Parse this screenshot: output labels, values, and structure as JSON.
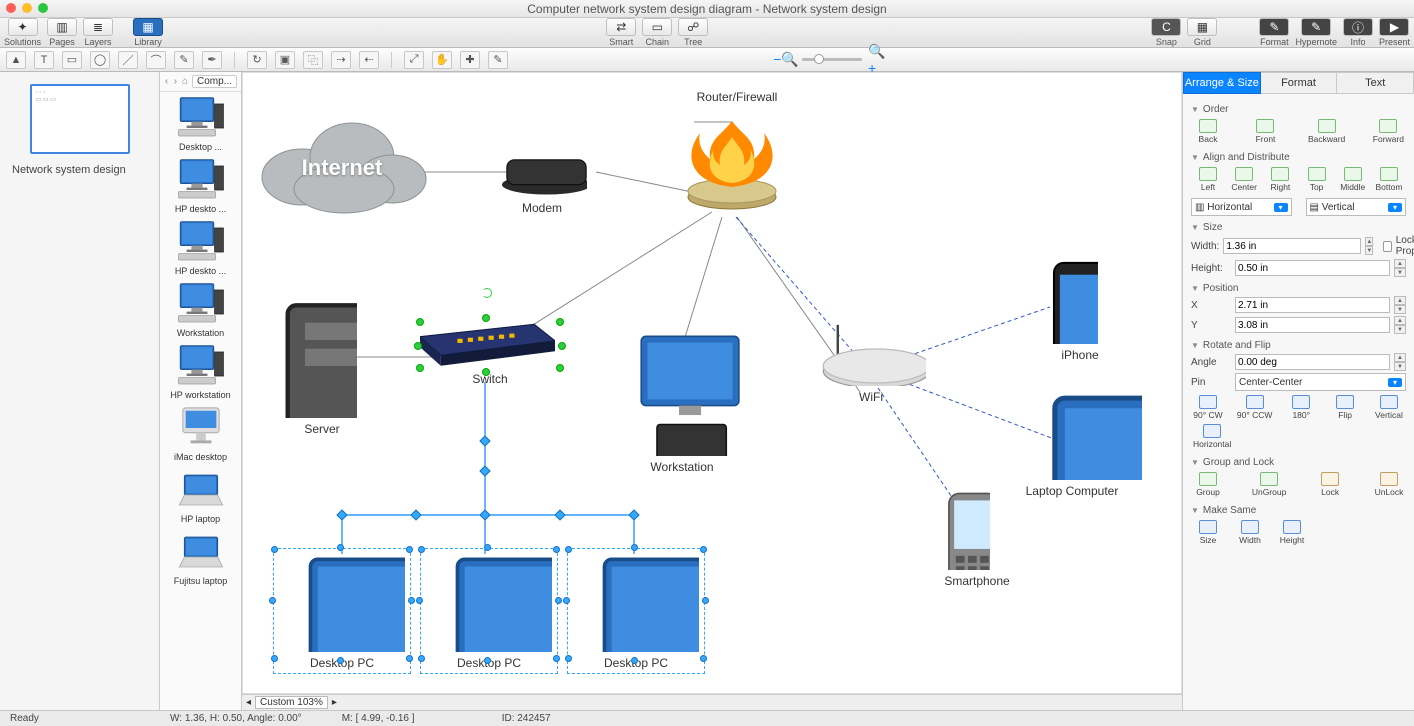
{
  "window": {
    "title": "Computer network system design diagram - Network system design"
  },
  "toolbar": {
    "left": [
      {
        "id": "solutions",
        "label": "Solutions"
      },
      {
        "id": "pages",
        "label": "Pages"
      },
      {
        "id": "layers",
        "label": "Layers"
      }
    ],
    "library": {
      "label": "Library"
    },
    "center": [
      {
        "id": "smart",
        "label": "Smart"
      },
      {
        "id": "chain",
        "label": "Chain"
      },
      {
        "id": "tree",
        "label": "Tree"
      }
    ],
    "right": [
      {
        "id": "snap",
        "label": "Snap"
      },
      {
        "id": "grid",
        "label": "Grid"
      }
    ],
    "far_right": [
      {
        "id": "format",
        "label": "Format"
      },
      {
        "id": "hypernote",
        "label": "Hypernote"
      },
      {
        "id": "info",
        "label": "Info"
      },
      {
        "id": "present",
        "label": "Present"
      }
    ]
  },
  "thumbs": {
    "caption": "Network system design"
  },
  "library": {
    "crumb": "Comp...",
    "items": [
      {
        "id": "desktop",
        "label": "Desktop ..."
      },
      {
        "id": "hpdesk1",
        "label": "HP deskto ..."
      },
      {
        "id": "hpdesk2",
        "label": "HP deskto ..."
      },
      {
        "id": "workstation",
        "label": "Workstation"
      },
      {
        "id": "hpws",
        "label": "HP workstation"
      },
      {
        "id": "imac",
        "label": "iMac desktop"
      },
      {
        "id": "hplap",
        "label": "HP laptop"
      },
      {
        "id": "fujitsu",
        "label": "Fujitsu laptop"
      }
    ]
  },
  "canvas": {
    "nodes": {
      "internet": {
        "label": "Internet"
      },
      "modem": {
        "label": "Modem"
      },
      "router": {
        "label": "Router/Firewall"
      },
      "switch": {
        "label": "Switch"
      },
      "server": {
        "label": "Server"
      },
      "wifi": {
        "label": "WiFi"
      },
      "iphone": {
        "label": "iPhone"
      },
      "laptop": {
        "label": "Laptop Computer"
      },
      "smartphone": {
        "label": "Smartphone"
      },
      "workstation": {
        "label": "Workstation"
      },
      "pc1": {
        "label": "Desktop PC"
      },
      "pc2": {
        "label": "Desktop PC"
      },
      "pc3": {
        "label": "Desktop PC"
      }
    }
  },
  "canvas_foot": {
    "zoom_label": "Custom 103%"
  },
  "inspector": {
    "tabs": {
      "arrange": "Arrange & Size",
      "format": "Format",
      "text": "Text"
    },
    "order": {
      "title": "Order",
      "back": "Back",
      "front": "Front",
      "backward": "Backward",
      "forward": "Forward"
    },
    "align": {
      "title": "Align and Distribute",
      "left": "Left",
      "center": "Center",
      "right": "Right",
      "top": "Top",
      "middle": "Middle",
      "bottom": "Bottom",
      "horizontal": "Horizontal",
      "vertical": "Vertical"
    },
    "size": {
      "title": "Size",
      "width_label": "Width:",
      "width_val": "1.36 in",
      "height_label": "Height:",
      "height_val": "0.50 in",
      "lock_label": "Lock Proportions"
    },
    "position": {
      "title": "Position",
      "x_label": "X",
      "x_val": "2.71 in",
      "y_label": "Y",
      "y_val": "3.08 in"
    },
    "rotate": {
      "title": "Rotate and Flip",
      "angle_label": "Angle",
      "angle_val": "0.00 deg",
      "pin_label": "Pin",
      "pin_val": "Center-Center",
      "cw": "90° CW",
      "ccw": "90° CCW",
      "r180": "180°",
      "flip": "Flip",
      "vert": "Vertical",
      "horiz": "Horizontal"
    },
    "group": {
      "title": "Group and Lock",
      "group": "Group",
      "ungroup": "UnGroup",
      "lock": "Lock",
      "unlock": "UnLock"
    },
    "same": {
      "title": "Make Same",
      "size": "Size",
      "width": "Width",
      "height": "Height"
    }
  },
  "status": {
    "ready": "Ready",
    "dims": "W: 1.36,  H: 0.50,  Angle: 0.00°",
    "mouse": "M: [ 4.99, -0.16 ]",
    "id": "ID: 242457"
  }
}
